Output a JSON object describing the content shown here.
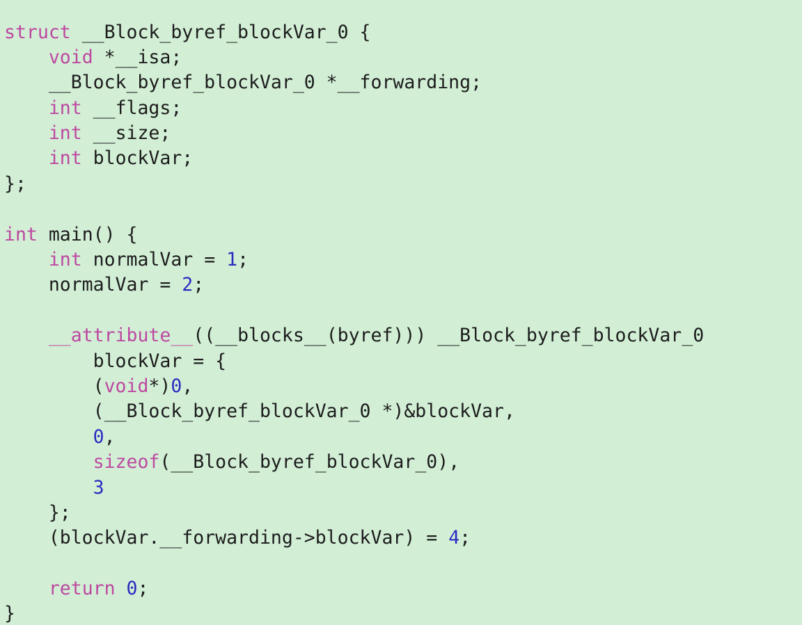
{
  "editor": {
    "language": "c",
    "background_color": "#d2efd6",
    "plain_color": "#1c1c1c",
    "keyword_color": "#bd48a0",
    "number_color": "#2b2bc0",
    "font_size_px": 26.5,
    "line_height_px": 36.4,
    "indent_spaces": 4,
    "total_lines": 24
  },
  "code": {
    "lines": [
      {
        "n": 1,
        "tokens": [
          {
            "t": "kw",
            "v": "struct"
          },
          {
            "t": "pln",
            "v": " __Block_byref_blockVar_0 {"
          }
        ]
      },
      {
        "n": 2,
        "tokens": [
          {
            "t": "pln",
            "v": "    "
          },
          {
            "t": "kw",
            "v": "void"
          },
          {
            "t": "pln",
            "v": " *__isa;"
          }
        ]
      },
      {
        "n": 3,
        "tokens": [
          {
            "t": "pln",
            "v": "    __Block_byref_blockVar_0 *__forwarding;"
          }
        ]
      },
      {
        "n": 4,
        "tokens": [
          {
            "t": "pln",
            "v": "    "
          },
          {
            "t": "kw",
            "v": "int"
          },
          {
            "t": "pln",
            "v": " __flags;"
          }
        ]
      },
      {
        "n": 5,
        "tokens": [
          {
            "t": "pln",
            "v": "    "
          },
          {
            "t": "kw",
            "v": "int"
          },
          {
            "t": "pln",
            "v": " __size;"
          }
        ]
      },
      {
        "n": 6,
        "tokens": [
          {
            "t": "pln",
            "v": "    "
          },
          {
            "t": "kw",
            "v": "int"
          },
          {
            "t": "pln",
            "v": " blockVar;"
          }
        ]
      },
      {
        "n": 7,
        "tokens": [
          {
            "t": "pln",
            "v": "};"
          }
        ]
      },
      {
        "n": 8,
        "tokens": [
          {
            "t": "pln",
            "v": ""
          }
        ]
      },
      {
        "n": 9,
        "tokens": [
          {
            "t": "kw",
            "v": "int"
          },
          {
            "t": "pln",
            "v": " main() {"
          }
        ]
      },
      {
        "n": 10,
        "tokens": [
          {
            "t": "pln",
            "v": "    "
          },
          {
            "t": "kw",
            "v": "int"
          },
          {
            "t": "pln",
            "v": " normalVar = "
          },
          {
            "t": "num",
            "v": "1"
          },
          {
            "t": "pln",
            "v": ";"
          }
        ]
      },
      {
        "n": 11,
        "tokens": [
          {
            "t": "pln",
            "v": "    normalVar = "
          },
          {
            "t": "num",
            "v": "2"
          },
          {
            "t": "pln",
            "v": ";"
          }
        ]
      },
      {
        "n": 12,
        "tokens": [
          {
            "t": "pln",
            "v": ""
          }
        ]
      },
      {
        "n": 13,
        "tokens": [
          {
            "t": "pln",
            "v": "    "
          },
          {
            "t": "kw",
            "v": "__attribute__"
          },
          {
            "t": "pln",
            "v": "((__blocks__(byref))) __Block_byref_blockVar_0"
          }
        ]
      },
      {
        "n": 14,
        "tokens": [
          {
            "t": "pln",
            "v": "        blockVar = {"
          }
        ]
      },
      {
        "n": 15,
        "tokens": [
          {
            "t": "pln",
            "v": "        ("
          },
          {
            "t": "kw",
            "v": "void"
          },
          {
            "t": "pln",
            "v": "*)"
          },
          {
            "t": "num",
            "v": "0"
          },
          {
            "t": "pln",
            "v": ","
          }
        ]
      },
      {
        "n": 16,
        "tokens": [
          {
            "t": "pln",
            "v": "        (__Block_byref_blockVar_0 *)&blockVar,"
          }
        ]
      },
      {
        "n": 17,
        "tokens": [
          {
            "t": "pln",
            "v": "        "
          },
          {
            "t": "num",
            "v": "0"
          },
          {
            "t": "pln",
            "v": ","
          }
        ]
      },
      {
        "n": 18,
        "tokens": [
          {
            "t": "pln",
            "v": "        "
          },
          {
            "t": "kw",
            "v": "sizeof"
          },
          {
            "t": "pln",
            "v": "(__Block_byref_blockVar_0),"
          }
        ]
      },
      {
        "n": 19,
        "tokens": [
          {
            "t": "pln",
            "v": "        "
          },
          {
            "t": "num",
            "v": "3"
          }
        ]
      },
      {
        "n": 20,
        "tokens": [
          {
            "t": "pln",
            "v": "    };"
          }
        ]
      },
      {
        "n": 21,
        "tokens": [
          {
            "t": "pln",
            "v": "    (blockVar.__forwarding->blockVar) = "
          },
          {
            "t": "num",
            "v": "4"
          },
          {
            "t": "pln",
            "v": ";"
          }
        ]
      },
      {
        "n": 22,
        "tokens": [
          {
            "t": "pln",
            "v": ""
          }
        ]
      },
      {
        "n": 23,
        "tokens": [
          {
            "t": "pln",
            "v": "    "
          },
          {
            "t": "kw",
            "v": "return"
          },
          {
            "t": "pln",
            "v": " "
          },
          {
            "t": "num",
            "v": "0"
          },
          {
            "t": "pln",
            "v": ";"
          }
        ]
      },
      {
        "n": 24,
        "tokens": [
          {
            "t": "pln",
            "v": "}"
          }
        ]
      }
    ]
  }
}
